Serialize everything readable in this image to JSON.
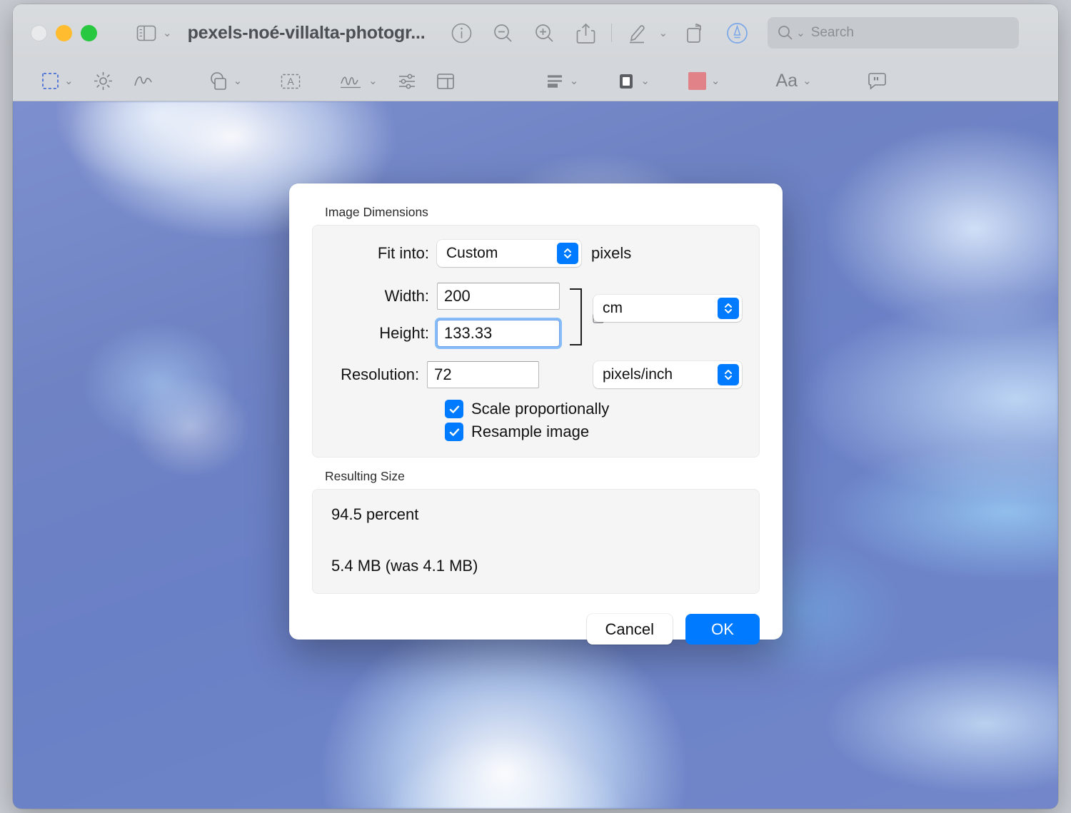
{
  "window": {
    "title": "pexels-noé-villalta-photogr...",
    "traffic_lights": [
      "close",
      "minimize",
      "zoom"
    ]
  },
  "toolbar_top": {
    "sidebar_button": "sidebar-icon",
    "items": [
      {
        "name": "info-icon",
        "label": "Info"
      },
      {
        "name": "zoom-out-icon",
        "label": "Zoom Out"
      },
      {
        "name": "zoom-in-icon",
        "label": "Zoom In"
      },
      {
        "name": "share-icon",
        "label": "Share"
      },
      {
        "name": "highlight-icon",
        "label": "Highlight"
      },
      {
        "name": "rotate-icon",
        "label": "Rotate"
      },
      {
        "name": "markup-icon",
        "label": "Markup"
      }
    ],
    "search": {
      "placeholder": "Search",
      "value": ""
    }
  },
  "toolbar_markup": {
    "items": [
      {
        "name": "rectangular-selection-icon",
        "label": "Selection Tools"
      },
      {
        "name": "instant-alpha-icon",
        "label": "Instant Alpha"
      },
      {
        "name": "sketch-icon",
        "label": "Sketch"
      },
      {
        "name": "shapes-icon",
        "label": "Shapes"
      },
      {
        "name": "text-icon",
        "label": "Text"
      },
      {
        "name": "sign-icon",
        "label": "Sign"
      },
      {
        "name": "adjust-color-icon",
        "label": "Adjust Color"
      },
      {
        "name": "adjust-size-icon",
        "label": "Adjust Size"
      },
      {
        "name": "shape-style-icon",
        "label": "Shape Style"
      },
      {
        "name": "border-color-icon",
        "label": "Border Color"
      },
      {
        "name": "fill-color-icon",
        "label": "Fill Color"
      },
      {
        "name": "text-style-icon",
        "label": "Aa"
      },
      {
        "name": "annotate-icon",
        "label": "Annotate"
      }
    ],
    "fill_color": "#e08288"
  },
  "dialog": {
    "image_dimensions": {
      "group_label": "Image Dimensions",
      "fit_into_label": "Fit into:",
      "fit_into_value": "Custom",
      "fit_into_suffix": "pixels",
      "width_label": "Width:",
      "width_value": "200",
      "height_label": "Height:",
      "height_value": "133.33",
      "size_unit_value": "cm",
      "resolution_label": "Resolution:",
      "resolution_value": "72",
      "resolution_unit_value": "pixels/inch",
      "scale_proportionally_label": "Scale proportionally",
      "scale_proportionally_checked": true,
      "resample_image_label": "Resample image",
      "resample_image_checked": true,
      "link_lock": "lock-icon"
    },
    "resulting_size": {
      "group_label": "Resulting Size",
      "percent_line": "94.5 percent",
      "size_line": "5.4 MB (was 4.1 MB)"
    },
    "buttons": {
      "cancel": "Cancel",
      "ok": "OK"
    }
  },
  "colors": {
    "accent": "#007aff",
    "minimize": "#febc2e",
    "zoom": "#28c840",
    "fill_swatch": "#e08288"
  }
}
